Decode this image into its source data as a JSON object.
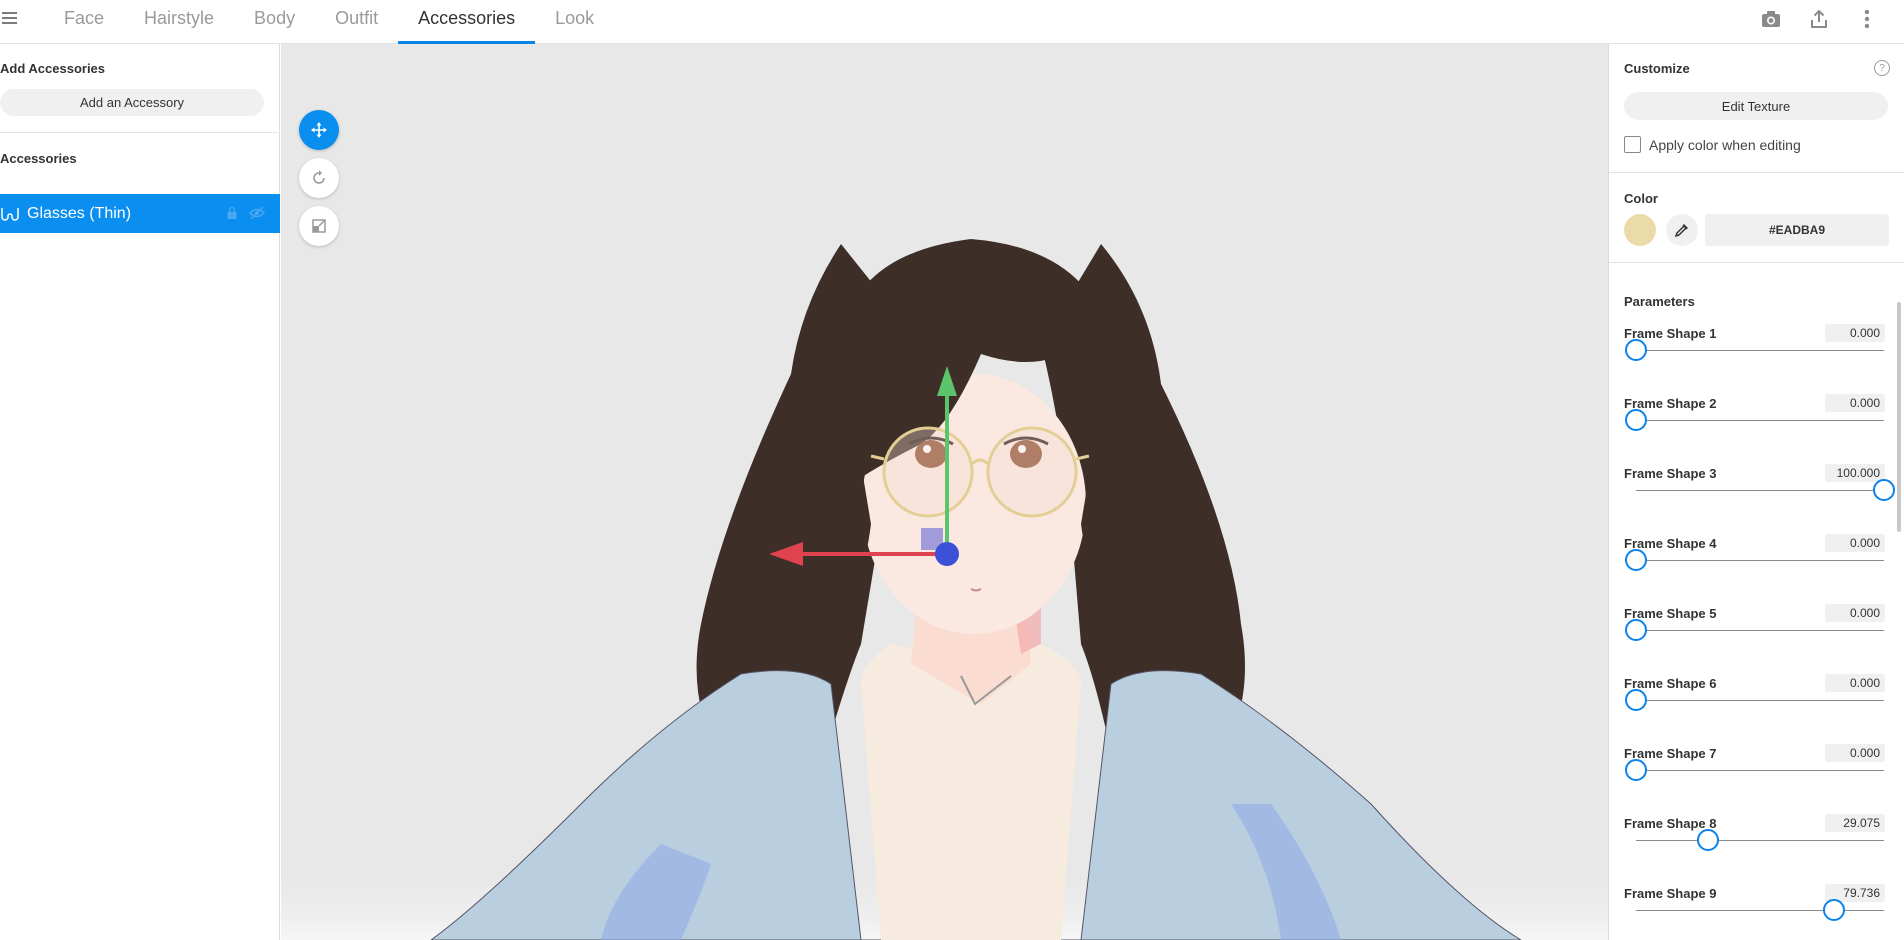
{
  "tabs": [
    {
      "label": "Face"
    },
    {
      "label": "Hairstyle"
    },
    {
      "label": "Body"
    },
    {
      "label": "Outfit"
    },
    {
      "label": "Accessories",
      "active": true
    },
    {
      "label": "Look"
    }
  ],
  "topbar_icons": [
    "menu-icon",
    "camera-icon",
    "export-icon",
    "more-vertical-icon"
  ],
  "left_panel": {
    "add_title": "Add Accessories",
    "add_button": "Add an Accessory",
    "list_title": "Accessories",
    "items": [
      {
        "label": "Glasses (Thin)",
        "icon": "glasses-icon",
        "selected": true
      }
    ]
  },
  "viewport": {
    "tools": [
      "move-tool-icon",
      "rotate-tool-icon",
      "scale-tool-icon"
    ],
    "active_tool": "move-tool-icon"
  },
  "right_panel": {
    "customize_title": "Customize",
    "help_label": "?",
    "edit_texture": "Edit Texture",
    "apply_color_label": "Apply color when editing",
    "apply_color_checked": false,
    "color_title": "Color",
    "color_hex": "#EADBA9",
    "parameters_title": "Parameters",
    "parameters": [
      {
        "label": "Frame Shape 1",
        "value": "0.000",
        "fraction": 0.0
      },
      {
        "label": "Frame Shape 2",
        "value": "0.000",
        "fraction": 0.0
      },
      {
        "label": "Frame Shape 3",
        "value": "100.000",
        "fraction": 1.0
      },
      {
        "label": "Frame Shape 4",
        "value": "0.000",
        "fraction": 0.0
      },
      {
        "label": "Frame Shape 5",
        "value": "0.000",
        "fraction": 0.0
      },
      {
        "label": "Frame Shape 6",
        "value": "0.000",
        "fraction": 0.0
      },
      {
        "label": "Frame Shape 7",
        "value": "0.000",
        "fraction": 0.0
      },
      {
        "label": "Frame Shape 8",
        "value": "29.075",
        "fraction": 0.29075
      },
      {
        "label": "Frame Shape 9",
        "value": "79.736",
        "fraction": 0.79736
      }
    ]
  },
  "colors": {
    "accent": "#0A8FF0",
    "selected_row": "#0A8FF0",
    "swatch": "#EADBA9"
  }
}
